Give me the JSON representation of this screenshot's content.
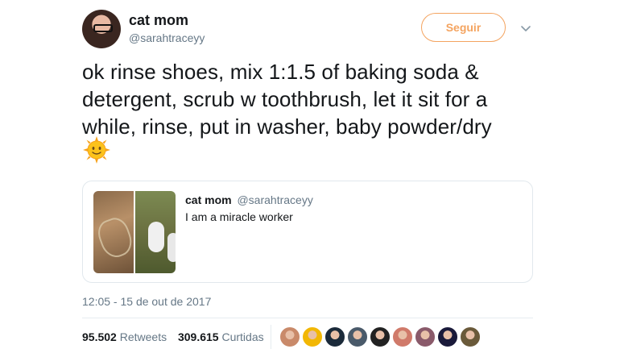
{
  "tweet": {
    "author_name": "cat mom",
    "author_handle": "@sarahtraceyy",
    "follow_label": "Seguir",
    "text": "ok rinse shoes, mix 1:1.5 of baking soda & detergent, scrub w toothbrush, let it sit for a while, rinse, put in washer, baby powder/dry",
    "emoji": "sun-with-face",
    "timestamp": "12:05 - 15 de out de 2017"
  },
  "quote": {
    "author_name": "cat mom",
    "author_handle": "@sarahtraceyy",
    "text": "I am a miracle worker"
  },
  "stats": {
    "retweets_count": "95.502",
    "retweets_label": "Retweets",
    "likes_count": "309.615",
    "likes_label": "Curtidas"
  },
  "likers": [
    {
      "color": "#c98a6a"
    },
    {
      "color": "#f2b705"
    },
    {
      "color": "#1b2a3a"
    },
    {
      "color": "#4a5a6a"
    },
    {
      "color": "#222222"
    },
    {
      "color": "#d07a6a"
    },
    {
      "color": "#8a5a6a"
    },
    {
      "color": "#1a1a3a"
    },
    {
      "color": "#6a5a3a"
    }
  ],
  "colors": {
    "follow_accent": "#f4a460",
    "secondary_text": "#657786",
    "primary_text": "#14171a",
    "border": "#e1e8ed"
  }
}
